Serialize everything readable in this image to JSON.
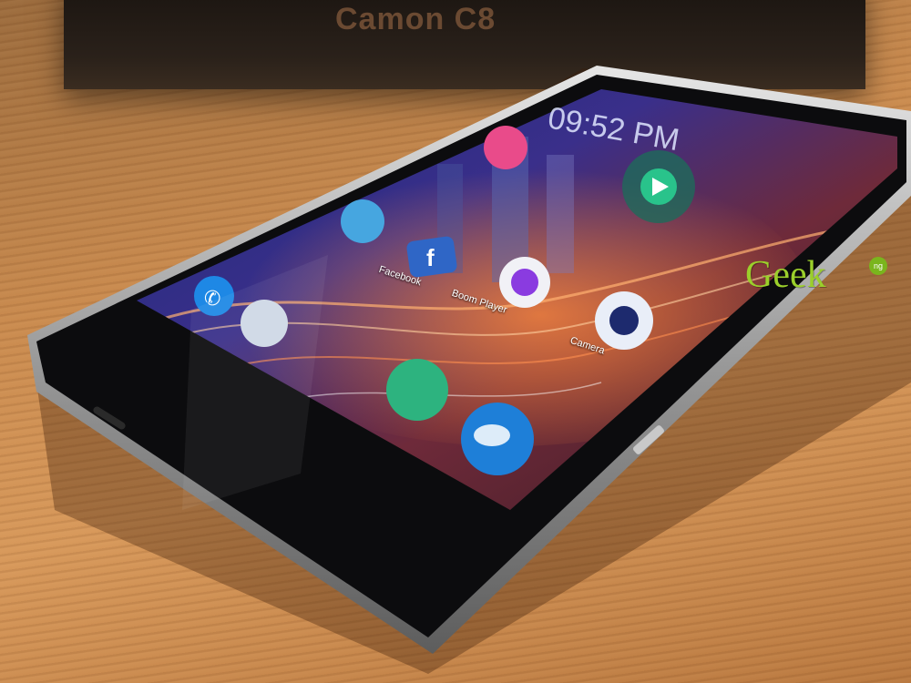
{
  "background": {
    "box_text": "Camon C8",
    "watermark": "Geek",
    "watermark_suffix": "ng"
  },
  "phone": {
    "screen": {
      "icons": [
        {
          "name": "whatsapp-icon"
        },
        {
          "name": "facebook-icon"
        },
        {
          "name": "boom-player-icon"
        },
        {
          "name": "camera-icon"
        },
        {
          "name": "phone-icon"
        },
        {
          "name": "contacts-icon"
        },
        {
          "name": "messages-icon"
        },
        {
          "name": "browser-icon"
        },
        {
          "name": "music-widget-icon"
        }
      ],
      "labels": {
        "facebook": "Facebook",
        "boom_player": "Boom Player",
        "camera": "Camera"
      }
    }
  },
  "colors": {
    "screen_bg": "#241a55",
    "phone_frame": "#b8b8b8",
    "accent_green": "#2bb673"
  }
}
